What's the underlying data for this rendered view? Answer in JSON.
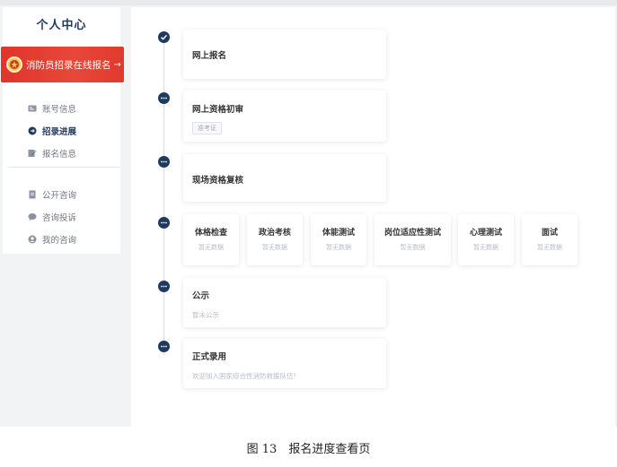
{
  "sidebar": {
    "title": "个人中心",
    "banner": {
      "label": "消防员招录在线报名",
      "arrow": "→"
    },
    "menu_group_1": [
      {
        "label": "账号信息",
        "icon": "id-card-icon",
        "active": false
      },
      {
        "label": "招录进展",
        "icon": "progress-icon",
        "active": true
      },
      {
        "label": "报名信息",
        "icon": "edit-doc-icon",
        "active": false
      }
    ],
    "menu_group_2": [
      {
        "label": "公开咨询",
        "icon": "document-icon"
      },
      {
        "label": "咨询投诉",
        "icon": "chat-icon"
      },
      {
        "label": "我的咨询",
        "icon": "user-icon"
      }
    ]
  },
  "timeline": {
    "steps": [
      {
        "title": "网上报名",
        "status": "done"
      },
      {
        "title": "网上资格初审",
        "tag": "准考证",
        "status": "pending"
      },
      {
        "title": "现场资格复核",
        "status": "pending"
      },
      {
        "status": "pending",
        "substeps": [
          {
            "title": "体格检查",
            "sub": "暂无数据"
          },
          {
            "title": "政治考核",
            "sub": "暂无数据"
          },
          {
            "title": "体能测试",
            "sub": "暂无数据"
          },
          {
            "title": "岗位适应性测试",
            "sub": "暂无数据"
          },
          {
            "title": "心理测试",
            "sub": "暂无数据"
          },
          {
            "title": "面试",
            "sub": "暂无数据"
          }
        ]
      },
      {
        "title": "公示",
        "sub": "暂未公示",
        "status": "pending"
      },
      {
        "title": "正式录用",
        "sub": "欢迎加入国家综合性消防救援队伍!",
        "status": "pending"
      }
    ]
  },
  "caption": "图 13　报名进度查看页",
  "colors": {
    "primary": "#1f3a5f",
    "banner": "#e0352c",
    "background": "#f2f3f5"
  }
}
